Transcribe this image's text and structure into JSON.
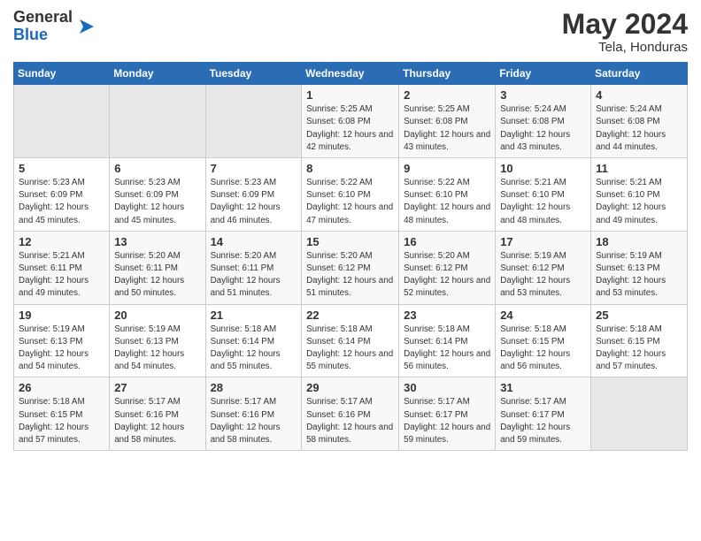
{
  "logo": {
    "general": "General",
    "blue": "Blue"
  },
  "title": "May 2024",
  "location": "Tela, Honduras",
  "headers": [
    "Sunday",
    "Monday",
    "Tuesday",
    "Wednesday",
    "Thursday",
    "Friday",
    "Saturday"
  ],
  "weeks": [
    [
      {
        "day": "",
        "sunrise": "",
        "sunset": "",
        "daylight": "",
        "empty": true
      },
      {
        "day": "",
        "sunrise": "",
        "sunset": "",
        "daylight": "",
        "empty": true
      },
      {
        "day": "",
        "sunrise": "",
        "sunset": "",
        "daylight": "",
        "empty": true
      },
      {
        "day": "1",
        "sunrise": "Sunrise: 5:25 AM",
        "sunset": "Sunset: 6:08 PM",
        "daylight": "Daylight: 12 hours and 42 minutes."
      },
      {
        "day": "2",
        "sunrise": "Sunrise: 5:25 AM",
        "sunset": "Sunset: 6:08 PM",
        "daylight": "Daylight: 12 hours and 43 minutes."
      },
      {
        "day": "3",
        "sunrise": "Sunrise: 5:24 AM",
        "sunset": "Sunset: 6:08 PM",
        "daylight": "Daylight: 12 hours and 43 minutes."
      },
      {
        "day": "4",
        "sunrise": "Sunrise: 5:24 AM",
        "sunset": "Sunset: 6:08 PM",
        "daylight": "Daylight: 12 hours and 44 minutes."
      }
    ],
    [
      {
        "day": "5",
        "sunrise": "Sunrise: 5:23 AM",
        "sunset": "Sunset: 6:09 PM",
        "daylight": "Daylight: 12 hours and 45 minutes."
      },
      {
        "day": "6",
        "sunrise": "Sunrise: 5:23 AM",
        "sunset": "Sunset: 6:09 PM",
        "daylight": "Daylight: 12 hours and 45 minutes."
      },
      {
        "day": "7",
        "sunrise": "Sunrise: 5:23 AM",
        "sunset": "Sunset: 6:09 PM",
        "daylight": "Daylight: 12 hours and 46 minutes."
      },
      {
        "day": "8",
        "sunrise": "Sunrise: 5:22 AM",
        "sunset": "Sunset: 6:10 PM",
        "daylight": "Daylight: 12 hours and 47 minutes."
      },
      {
        "day": "9",
        "sunrise": "Sunrise: 5:22 AM",
        "sunset": "Sunset: 6:10 PM",
        "daylight": "Daylight: 12 hours and 48 minutes."
      },
      {
        "day": "10",
        "sunrise": "Sunrise: 5:21 AM",
        "sunset": "Sunset: 6:10 PM",
        "daylight": "Daylight: 12 hours and 48 minutes."
      },
      {
        "day": "11",
        "sunrise": "Sunrise: 5:21 AM",
        "sunset": "Sunset: 6:10 PM",
        "daylight": "Daylight: 12 hours and 49 minutes."
      }
    ],
    [
      {
        "day": "12",
        "sunrise": "Sunrise: 5:21 AM",
        "sunset": "Sunset: 6:11 PM",
        "daylight": "Daylight: 12 hours and 49 minutes."
      },
      {
        "day": "13",
        "sunrise": "Sunrise: 5:20 AM",
        "sunset": "Sunset: 6:11 PM",
        "daylight": "Daylight: 12 hours and 50 minutes."
      },
      {
        "day": "14",
        "sunrise": "Sunrise: 5:20 AM",
        "sunset": "Sunset: 6:11 PM",
        "daylight": "Daylight: 12 hours and 51 minutes."
      },
      {
        "day": "15",
        "sunrise": "Sunrise: 5:20 AM",
        "sunset": "Sunset: 6:12 PM",
        "daylight": "Daylight: 12 hours and 51 minutes."
      },
      {
        "day": "16",
        "sunrise": "Sunrise: 5:20 AM",
        "sunset": "Sunset: 6:12 PM",
        "daylight": "Daylight: 12 hours and 52 minutes."
      },
      {
        "day": "17",
        "sunrise": "Sunrise: 5:19 AM",
        "sunset": "Sunset: 6:12 PM",
        "daylight": "Daylight: 12 hours and 53 minutes."
      },
      {
        "day": "18",
        "sunrise": "Sunrise: 5:19 AM",
        "sunset": "Sunset: 6:13 PM",
        "daylight": "Daylight: 12 hours and 53 minutes."
      }
    ],
    [
      {
        "day": "19",
        "sunrise": "Sunrise: 5:19 AM",
        "sunset": "Sunset: 6:13 PM",
        "daylight": "Daylight: 12 hours and 54 minutes."
      },
      {
        "day": "20",
        "sunrise": "Sunrise: 5:19 AM",
        "sunset": "Sunset: 6:13 PM",
        "daylight": "Daylight: 12 hours and 54 minutes."
      },
      {
        "day": "21",
        "sunrise": "Sunrise: 5:18 AM",
        "sunset": "Sunset: 6:14 PM",
        "daylight": "Daylight: 12 hours and 55 minutes."
      },
      {
        "day": "22",
        "sunrise": "Sunrise: 5:18 AM",
        "sunset": "Sunset: 6:14 PM",
        "daylight": "Daylight: 12 hours and 55 minutes."
      },
      {
        "day": "23",
        "sunrise": "Sunrise: 5:18 AM",
        "sunset": "Sunset: 6:14 PM",
        "daylight": "Daylight: 12 hours and 56 minutes."
      },
      {
        "day": "24",
        "sunrise": "Sunrise: 5:18 AM",
        "sunset": "Sunset: 6:15 PM",
        "daylight": "Daylight: 12 hours and 56 minutes."
      },
      {
        "day": "25",
        "sunrise": "Sunrise: 5:18 AM",
        "sunset": "Sunset: 6:15 PM",
        "daylight": "Daylight: 12 hours and 57 minutes."
      }
    ],
    [
      {
        "day": "26",
        "sunrise": "Sunrise: 5:18 AM",
        "sunset": "Sunset: 6:15 PM",
        "daylight": "Daylight: 12 hours and 57 minutes."
      },
      {
        "day": "27",
        "sunrise": "Sunrise: 5:17 AM",
        "sunset": "Sunset: 6:16 PM",
        "daylight": "Daylight: 12 hours and 58 minutes."
      },
      {
        "day": "28",
        "sunrise": "Sunrise: 5:17 AM",
        "sunset": "Sunset: 6:16 PM",
        "daylight": "Daylight: 12 hours and 58 minutes."
      },
      {
        "day": "29",
        "sunrise": "Sunrise: 5:17 AM",
        "sunset": "Sunset: 6:16 PM",
        "daylight": "Daylight: 12 hours and 58 minutes."
      },
      {
        "day": "30",
        "sunrise": "Sunrise: 5:17 AM",
        "sunset": "Sunset: 6:17 PM",
        "daylight": "Daylight: 12 hours and 59 minutes."
      },
      {
        "day": "31",
        "sunrise": "Sunrise: 5:17 AM",
        "sunset": "Sunset: 6:17 PM",
        "daylight": "Daylight: 12 hours and 59 minutes."
      },
      {
        "day": "",
        "sunrise": "",
        "sunset": "",
        "daylight": "",
        "empty": true
      }
    ]
  ]
}
